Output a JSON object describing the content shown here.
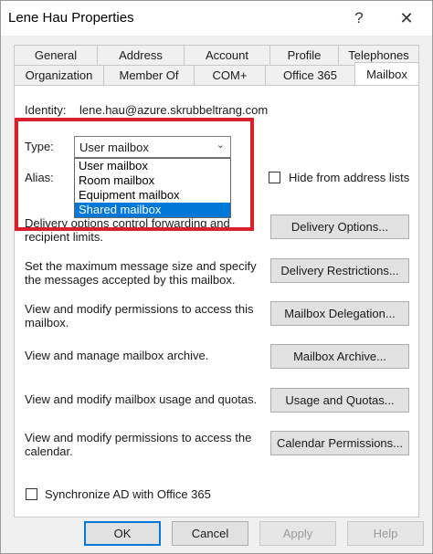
{
  "window": {
    "title": "Lene Hau Properties",
    "help_glyph": "?",
    "close_glyph": "✕"
  },
  "tabs": {
    "row1": [
      "General",
      "Address",
      "Account",
      "Profile",
      "Telephones"
    ],
    "row2": [
      "Organization",
      "Member Of",
      "COM+",
      "Office 365",
      "Mailbox"
    ],
    "active": "Mailbox"
  },
  "mailbox": {
    "identity_label": "Identity:",
    "identity_value": "lene.hau@azure.skrubbeltrang.com",
    "type_label": "Type:",
    "type_value": "User mailbox",
    "type_options": [
      "User mailbox",
      "Room mailbox",
      "Equipment mailbox",
      "Shared mailbox"
    ],
    "type_highlighted": "Shared mailbox",
    "alias_label": "Alias:",
    "hide_label": "Hide from address lists",
    "sections": [
      {
        "desc": "Delivery options control forwarding and recipient limits.",
        "button": "Delivery Options..."
      },
      {
        "desc": "Set the maximum message size and specify the messages accepted by this mailbox.",
        "button": "Delivery Restrictions..."
      },
      {
        "desc": "View and modify permissions to access this mailbox.",
        "button": "Mailbox Delegation..."
      },
      {
        "desc": "View and manage mailbox archive.",
        "button": "Mailbox Archive..."
      },
      {
        "desc": "View and modify mailbox usage and quotas.",
        "button": "Usage and Quotas..."
      },
      {
        "desc": "View and modify permissions to access the calendar.",
        "button": "Calendar Permissions..."
      }
    ],
    "sync_label": "Synchronize AD with Office 365"
  },
  "footer": {
    "ok": "OK",
    "cancel": "Cancel",
    "apply": "Apply",
    "help": "Help"
  },
  "colors": {
    "accent": "#0078d7",
    "highlight_border": "#d8212b"
  }
}
